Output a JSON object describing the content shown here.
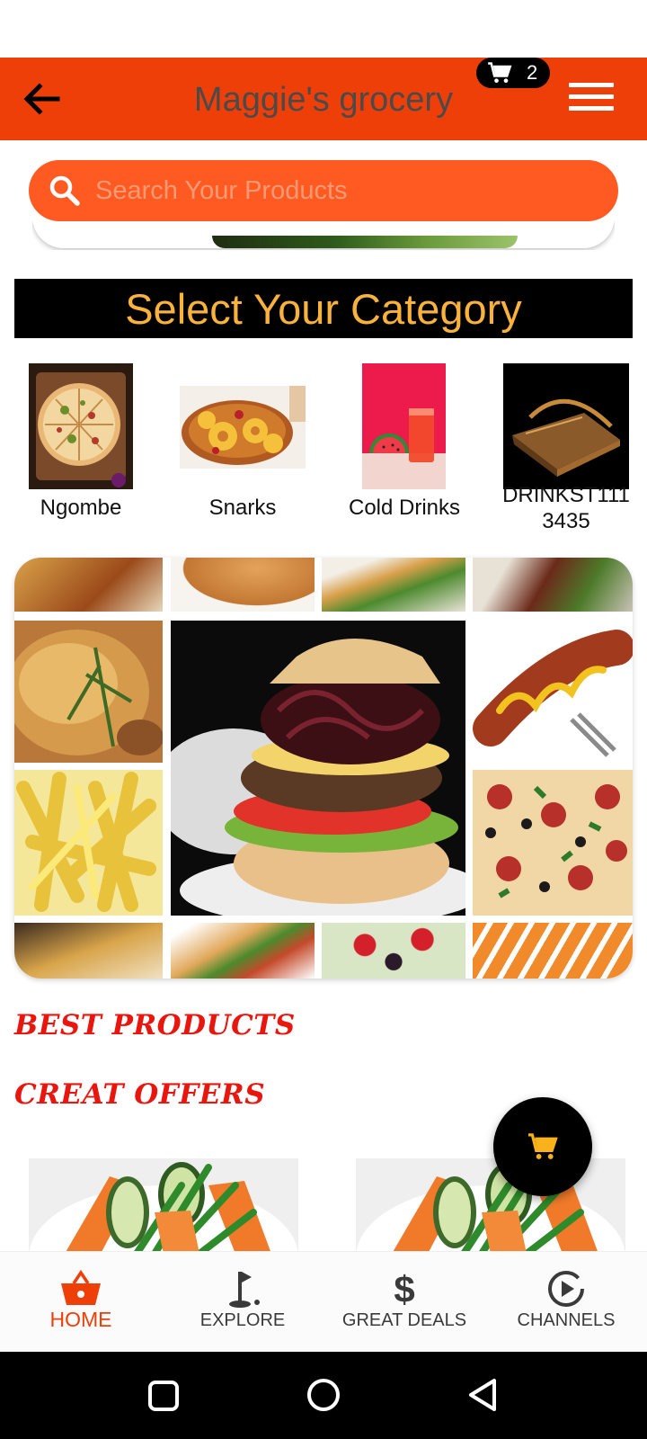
{
  "app_bar": {
    "title": "Maggie's grocery",
    "cart_count": "2"
  },
  "search": {
    "placeholder": "Search Your Products"
  },
  "category_section": {
    "title": "Select Your Category",
    "items": [
      {
        "label": "Ngombe",
        "image": "pizza-on-board"
      },
      {
        "label": "Snarks",
        "image": "pineapple-ham"
      },
      {
        "label": "Cold Drinks",
        "image": "watermelon-juice"
      },
      {
        "label": "DRINKST111 3435",
        "image": "leather-bag"
      }
    ]
  },
  "sections": {
    "best_products": "BEST PRODUCTS",
    "great_offers": "CREAT OFFERS"
  },
  "bottom_nav": {
    "items": [
      {
        "label": "HOME",
        "icon": "basket-icon",
        "active": true
      },
      {
        "label": "EXPLORE",
        "icon": "golf-flag-icon",
        "active": false
      },
      {
        "label": "GREAT DEALS",
        "icon": "dollar-icon",
        "active": false
      },
      {
        "label": "CHANNELS",
        "icon": "play-circle-icon",
        "active": false
      }
    ]
  },
  "colors": {
    "primary": "#ef3f08",
    "search_bg": "#fe5a22",
    "category_title": "#f9b23c",
    "section_title": "#e8160e",
    "fab_icon": "#f9b21a"
  },
  "icons": {
    "back": "arrow-left-icon",
    "cart": "cart-icon",
    "menu": "hamburger-menu-icon",
    "search": "search-icon",
    "fab": "cart-icon",
    "android": [
      "square-recents-icon",
      "circle-home-icon",
      "triangle-back-icon"
    ]
  }
}
